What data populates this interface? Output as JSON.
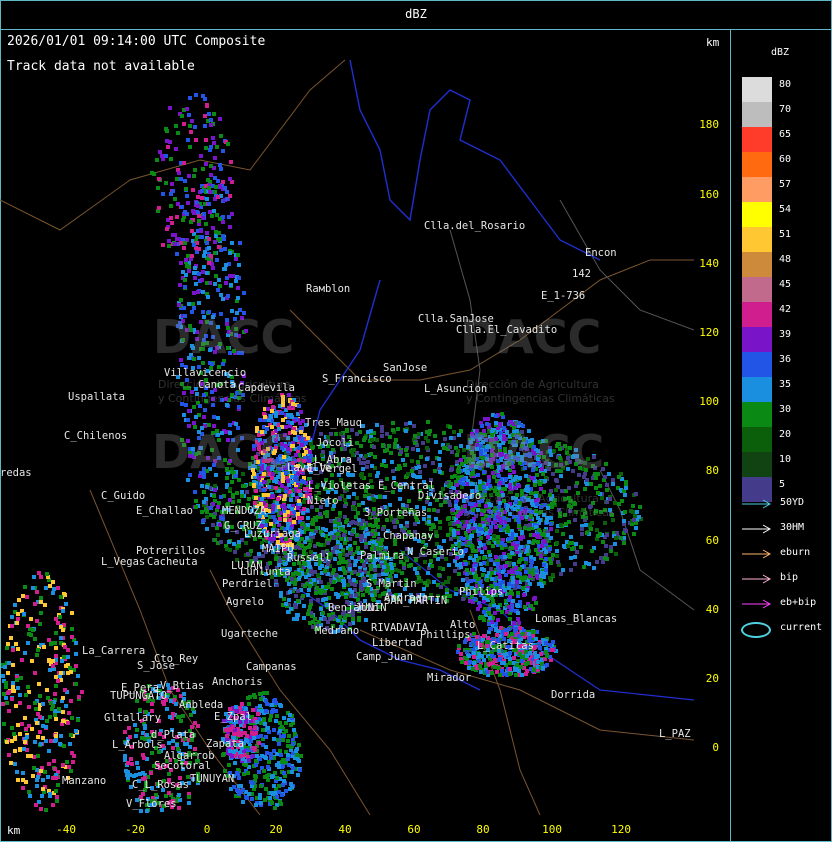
{
  "title": "dBZ",
  "header": {
    "timestamp": "2026/01/01 09:14:00 UTC Composite",
    "track_status": "Track data not available",
    "km_unit": "km"
  },
  "axes": {
    "x_label": "km",
    "x_ticks": [
      "-40",
      "-20",
      "0",
      "20",
      "40",
      "60",
      "80",
      "100",
      "120"
    ],
    "y_ticks": [
      "180",
      "160",
      "140",
      "120",
      "100",
      "80",
      "60",
      "40",
      "20",
      "0"
    ]
  },
  "watermark": {
    "brand": "DACC",
    "line1": "Dirección de Agricultura",
    "line2": "y Contingencias Climáticas"
  },
  "places": [
    "Clla.del_Rosario",
    "Encon",
    "142",
    "E_1-736",
    "Rамblon",
    "Clla.SanJose",
    "Clla.El_Cavadito",
    "Villavicencio",
    "Canota",
    "Capdevila",
    "S_Francisco",
    "SanJose",
    "L_Asuncion",
    "Uspallata",
    "Tres_Mauq",
    "Jocoli",
    "C_Chilenos",
    "L_Abra",
    "redas",
    "E_Vergel",
    "Lavalle",
    "L_Violetas",
    "E_Central",
    "Divisadero",
    "C_Guido",
    "E_Challao",
    "MENDOZA",
    "Nieto",
    "3_Porteñas",
    "G_CRUZ",
    "Luzuriaga",
    "Potrerillos",
    "Cacheuta",
    "L_Vegas",
    "MAIPU",
    "Russell",
    "LUJAN",
    "Lunlunta",
    "Perdriel",
    "Agrelo",
    "Ugarteche",
    "La_Carrera",
    "Cto_Rey",
    "S_Jose",
    "E_Pera",
    "TUPUNGATO",
    "V_Btias",
    "Anchoris",
    "Anbleda",
    "E_Zpal",
    "Gltallary",
    "d_Plata",
    "L_Arbols",
    "Algarrob",
    "Secotoral",
    "Manzano",
    "C_L_Rosas",
    "TUNUYAN",
    "V_Flores",
    "Zapata",
    "Campanas",
    "Camp_Juan",
    "Medrano",
    "RIVADAVIA",
    "Phillips",
    "Alto",
    "Libertad",
    "Mirador",
    "L_Catitas",
    "S_Martin",
    "JUNIN",
    "Andrade",
    "Benjamin",
    "Lomas_Blancas",
    "Dorrida",
    "L_PAZ",
    "Chapanay",
    "N_Caserio",
    "Palmira",
    "Philips",
    "SAN_MARTIN",
    "E_Perpa"
  ],
  "legend": {
    "title": "dBZ",
    "levels": [
      {
        "value": "80",
        "color": "#dcdcdc"
      },
      {
        "value": "70",
        "color": "#bdbdbd"
      },
      {
        "value": "65",
        "color": "#ff3b2a"
      },
      {
        "value": "60",
        "color": "#ff6a10"
      },
      {
        "value": "57",
        "color": "#ff9c64"
      },
      {
        "value": "54",
        "color": "#ffff00"
      },
      {
        "value": "51",
        "color": "#ffc832"
      },
      {
        "value": "48",
        "color": "#cc8a3a"
      },
      {
        "value": "45",
        "color": "#c26a8c"
      },
      {
        "value": "42",
        "color": "#d01e8e"
      },
      {
        "value": "39",
        "color": "#7a14c8"
      },
      {
        "value": "36",
        "color": "#2255e6"
      },
      {
        "value": "35",
        "color": "#1a8fe0"
      },
      {
        "value": "30",
        "color": "#0a8a14"
      },
      {
        "value": "20",
        "color": "#0b5f0b"
      },
      {
        "value": "10",
        "color": "#114211"
      },
      {
        "value": "5",
        "color": "#443c8a"
      }
    ],
    "tracks": [
      {
        "label": "50YD",
        "color": "#4fd0e0"
      },
      {
        "label": "30HM",
        "color": "#ffffff"
      },
      {
        "label": "eburn",
        "color": "#ffb46e"
      },
      {
        "label": "bip",
        "color": "#ffb4d8"
      },
      {
        "label": "eb+bip",
        "color": "#ff40ff"
      },
      {
        "label": "current",
        "color": "#4fd0e0"
      }
    ]
  }
}
